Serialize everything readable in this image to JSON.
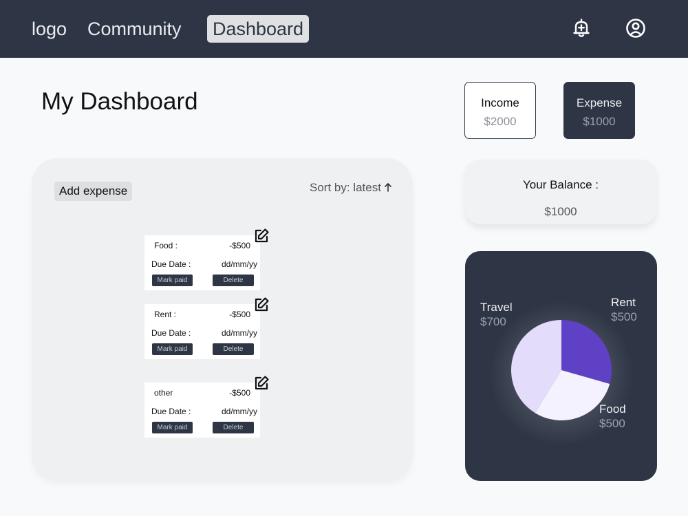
{
  "nav": {
    "logo": "logo",
    "community": "Community",
    "dashboard": "Dashboard"
  },
  "icons": {
    "bell": "bell-plus-icon",
    "account": "account-circle-icon",
    "edit": "edit-icon",
    "sort": "arrow-up-icon"
  },
  "colors": {
    "navy": "#2e3545",
    "travel": "#e3dcfb",
    "rent": "#5e41c4",
    "food": "#f4f2fe"
  },
  "page": {
    "title": "My Dashboard"
  },
  "summary": {
    "income_label": "Income",
    "income_value": "$2000",
    "expense_label": "Expense",
    "expense_value": "$1000"
  },
  "balance": {
    "label": "Your Balance :",
    "value": "$1000"
  },
  "expenses": {
    "add_label": "Add expense",
    "sort_label": "Sort by: latest",
    "items": [
      {
        "category": "Food :",
        "amount": "-$500",
        "due_label": "Due Date :",
        "due_value": "dd/mm/yy",
        "mark_label": "Mark paid",
        "delete_label": "Delete"
      },
      {
        "category": "Rent :",
        "amount": "-$500",
        "due_label": "Due Date :",
        "due_value": "dd/mm/yy",
        "mark_label": "Mark paid",
        "delete_label": "Delete"
      },
      {
        "category": "other",
        "amount": "-$500",
        "due_label": "Due Date :",
        "due_value": "dd/mm/yy",
        "mark_label": "Mark paid",
        "delete_label": "Delete"
      }
    ]
  },
  "chart_data": {
    "type": "pie",
    "title": "",
    "slices": [
      {
        "label": "Rent",
        "value_label": "$500",
        "value": 500,
        "color": "#5e41c4"
      },
      {
        "label": "Food",
        "value_label": "$500",
        "value": 500,
        "color": "#f4f2fe"
      },
      {
        "label": "Travel",
        "value_label": "$700",
        "value": 700,
        "color": "#e3dcfb"
      }
    ]
  }
}
